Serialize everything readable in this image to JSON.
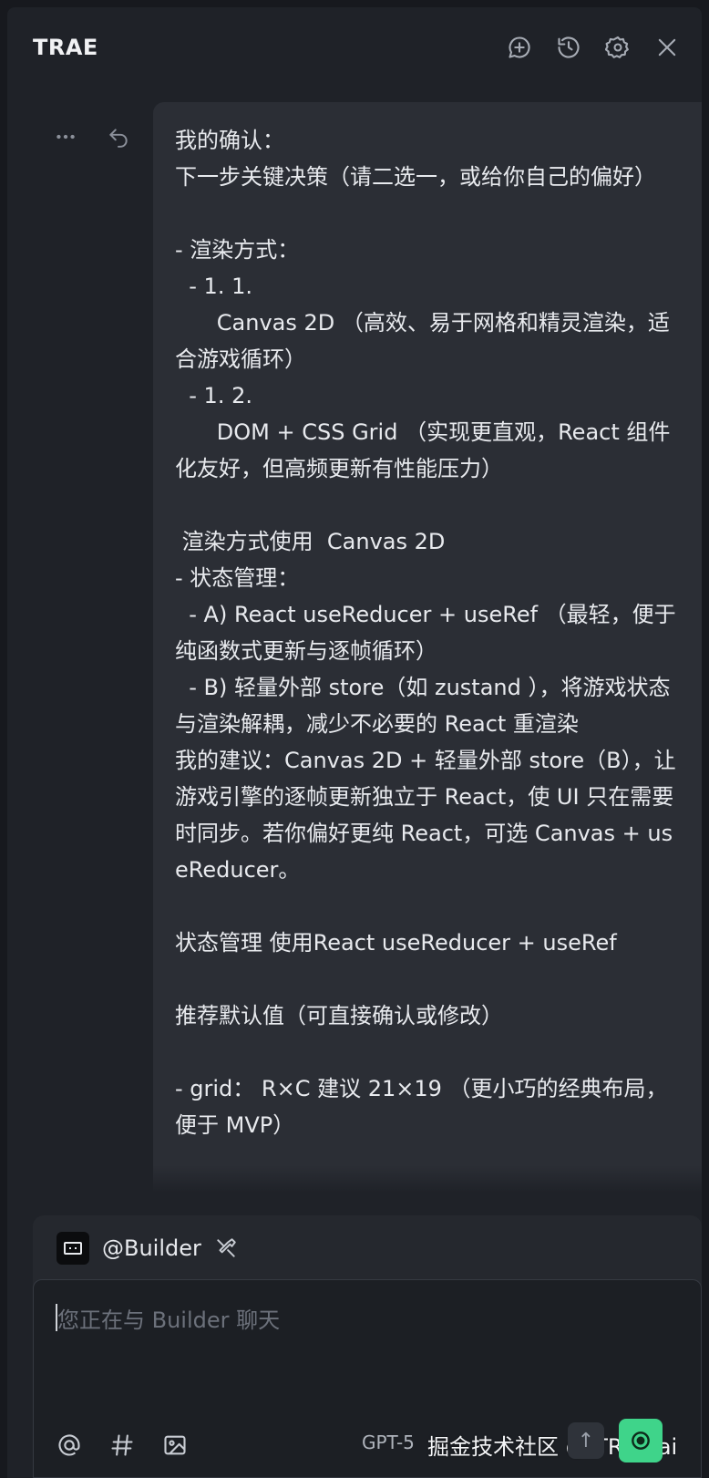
{
  "app": {
    "title": "TRAE"
  },
  "header_icons": [
    "new-chat-icon",
    "history-icon",
    "settings-icon",
    "close-icon"
  ],
  "message": {
    "actions": [
      "more-icon",
      "undo-icon"
    ],
    "text": "我的确认：\n下一步关键决策（请二选一，或给你自己的偏好）\n\n- 渲染方式：\n  - 1. 1.\n      Canvas 2D （高效、易于网格和精灵渲染，适合游戏循环）\n  - 1. 2.\n      DOM + CSS Grid （实现更直观，React 组件化友好，但高频更新有性能压力）\n\n 渲染方式使用  Canvas 2D\n- 状态管理：\n  - A) React useReducer + useRef （最轻，便于纯函数式更新与逐帧循环）\n  - B) 轻量外部 store（如 zustand ），将游戏状态与渲染解耦，减少不必要的 React 重渲染\n我的建议：Canvas 2D + 轻量外部 store（B），让游戏引擎的逐帧更新独立于 React，使 UI 只在需要时同步。若你偏好更纯 React，可选 Canvas + useReducer。\n\n状态管理 使用React useReducer + useRef\n\n推荐默认值（可直接确认或修改）\n\n- grid： R×C 建议 21×19 （更小巧的经典布局，便于 MVP）"
  },
  "composer": {
    "agent_name": "@Builder",
    "placeholder": "您正在与 Builder 聊天",
    "toolbar": [
      "at-icon",
      "hash-icon",
      "image-icon"
    ],
    "model": "GPT-5",
    "watermark": "掘金技术社区 @ TRAE.ai",
    "accent": "#3fd48a"
  }
}
